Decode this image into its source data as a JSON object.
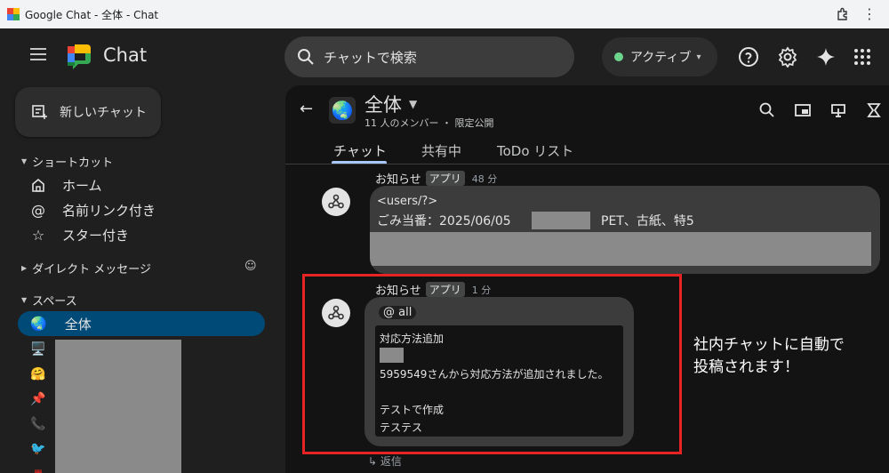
{
  "browser": {
    "title": "Google Chat - 全体 - Chat"
  },
  "app": {
    "name": "Chat"
  },
  "search": {
    "placeholder": "チャットで検索"
  },
  "status": {
    "label": "アクティブ",
    "color": "#6dd58c"
  },
  "sidebar": {
    "new_chat": "新しいチャット",
    "shortcuts_header": "ショートカット",
    "shortcuts": [
      {
        "icon": "home-icon",
        "label": "ホーム"
      },
      {
        "icon": "at-icon",
        "label": "名前リンク付き"
      },
      {
        "icon": "star-icon",
        "label": "スター付き"
      }
    ],
    "dm_header": "ダイレクト メッセージ",
    "spaces_header": "スペース",
    "active_space": {
      "emoji": "🌏",
      "label": "全体"
    },
    "space_icons": [
      "🖥️",
      "🤗",
      "📌",
      "📞",
      "🐦"
    ]
  },
  "space": {
    "emoji": "🌏",
    "name": "全体",
    "meta": "11 人のメンバー ・ 限定公開",
    "tabs": [
      "チャット",
      "共有中",
      "ToDo リスト"
    ]
  },
  "messages": [
    {
      "sender": "お知らせ",
      "badge": "アプリ",
      "time": "48 分",
      "line1": "<users/?>",
      "line2a": "ごみ当番：2025/06/05",
      "line2b": "PET、古紙、特5"
    },
    {
      "sender": "お知らせ",
      "badge": "アプリ",
      "time": "1 分",
      "mention": "@ all",
      "card_lines": [
        "対応方法追加",
        "5959549さんから対応方法が追加されました。",
        "テストで作成",
        "テステス"
      ]
    }
  ],
  "annotation": {
    "line1": "社内チャットに自動で",
    "line2": "投稿されます！",
    "color": "#e82323"
  },
  "reply": {
    "label": "返信"
  }
}
